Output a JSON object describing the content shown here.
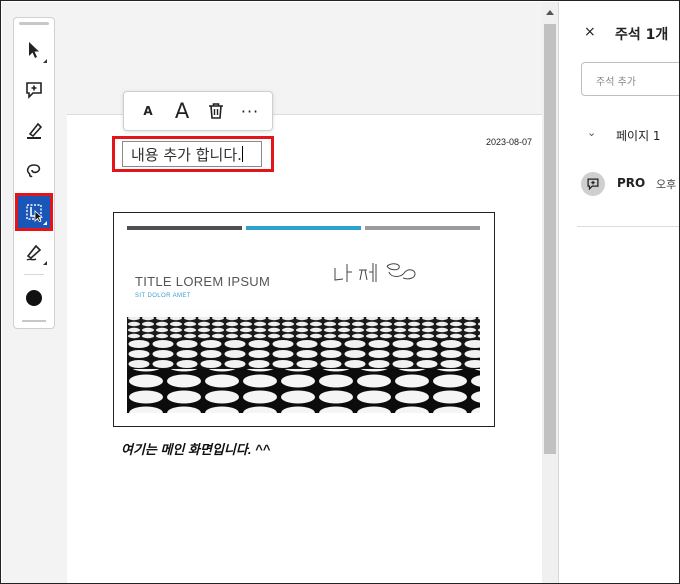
{
  "toolbar": {
    "tools": [
      {
        "name": "select-tool",
        "icon": "cursor-arrow-icon"
      },
      {
        "name": "add-comment-tool",
        "icon": "comment-plus-icon"
      },
      {
        "name": "highlight-tool",
        "icon": "highlighter-pen-icon"
      },
      {
        "name": "freehand-tool",
        "icon": "lasso-icon"
      },
      {
        "name": "text-box-tool",
        "icon": "text-box-icon",
        "active": true
      },
      {
        "name": "signature-tool",
        "icon": "pen-sign-icon"
      }
    ],
    "color": "#111111",
    "active_color": "#1a56b8",
    "highlight_outline_color": "#e3141a"
  },
  "float_toolbar": {
    "small_text_label": "A",
    "large_text_label": "A",
    "more_label": "···"
  },
  "document": {
    "annotation_text": "내용 추가 합니다.",
    "date": "2023-08-07",
    "slide": {
      "title": "TITLE LOREM IPSUM",
      "subtitle": "SIT DOLOR AMET",
      "bar_colors": [
        "#4d4f53",
        "#2ea2cc",
        "#9a9b9e"
      ]
    },
    "caption": "여기는 메인 화면입니다. ^^"
  },
  "comments_panel": {
    "close_label": "×",
    "title": "주석 1개",
    "input_placeholder": "주석 추가",
    "page_chevron": "⌄",
    "page_label": "페이지 1",
    "comment": {
      "author": "PRO",
      "time": "오후"
    }
  }
}
